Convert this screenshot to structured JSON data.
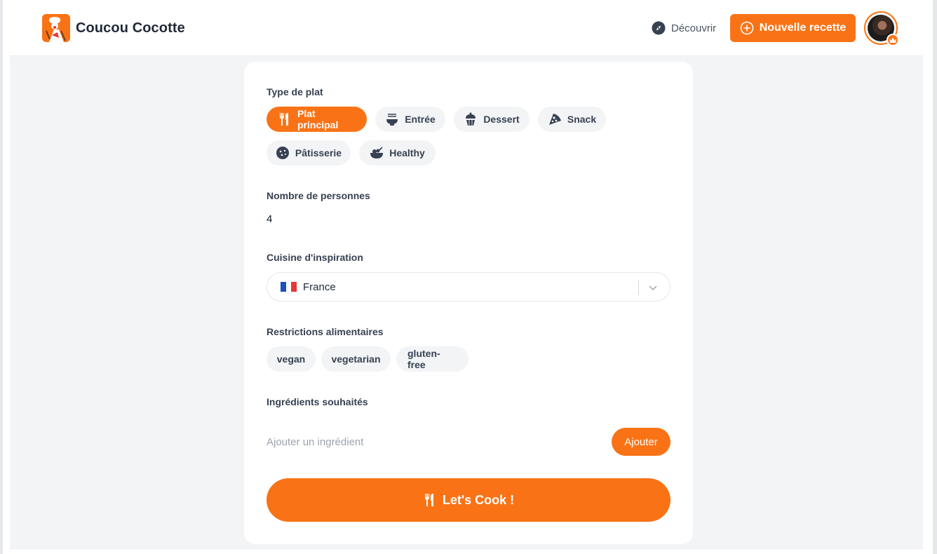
{
  "app": {
    "title": "Coucou Cocotte"
  },
  "nav": {
    "discover_label": "Découvrir",
    "new_recipe_label": "Nouvelle recette"
  },
  "form": {
    "dish_type": {
      "label": "Type de plat",
      "options": [
        {
          "label": "Plat principal",
          "icon": "utensils-icon",
          "selected": true
        },
        {
          "label": "Entrée",
          "icon": "bowl-icon",
          "selected": false
        },
        {
          "label": "Dessert",
          "icon": "cupcake-icon",
          "selected": false
        },
        {
          "label": "Snack",
          "icon": "pizza-slice-icon",
          "selected": false
        },
        {
          "label": "Pâtisserie",
          "icon": "cookie-icon",
          "selected": false
        },
        {
          "label": "Healthy",
          "icon": "salad-bowl-icon",
          "selected": false
        }
      ]
    },
    "servings": {
      "label": "Nombre de personnes",
      "value": "4"
    },
    "cuisine": {
      "label": "Cuisine d'inspiration",
      "selected": "France",
      "flag": "flag-france-icon"
    },
    "restrictions": {
      "label": "Restrictions alimentaires",
      "options": [
        "vegan",
        "vegetarian",
        "gluten-free"
      ]
    },
    "ingredients": {
      "label": "Ingrédients souhaités",
      "placeholder": "Ajouter un ingrédient",
      "value": "",
      "add_label": "Ajouter"
    },
    "submit_label": "Let's Cook !"
  },
  "colors": {
    "accent": "#f97316",
    "pill_bg": "#f3f4f6",
    "page_bg": "#f3f4f6",
    "text_dark": "#1f2937",
    "flag_blue": "#1e4fbf",
    "flag_white": "#ffffff",
    "flag_red": "#e53935"
  }
}
